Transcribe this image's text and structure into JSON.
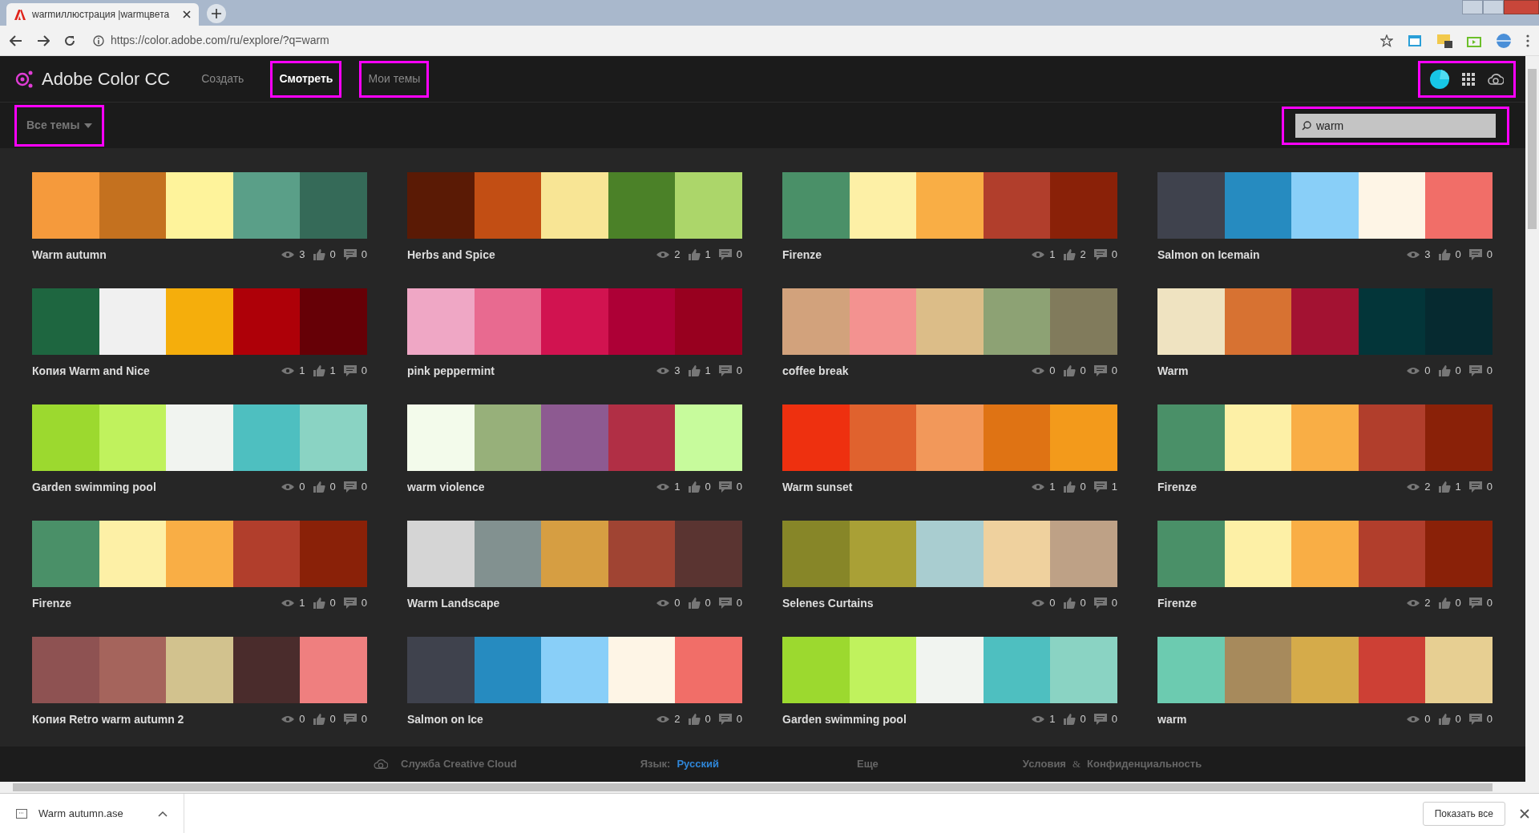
{
  "browser": {
    "tab_title": "warmиллюстрация |warmцвета",
    "url": "https://color.adobe.com/ru/explore/?q=warm"
  },
  "header": {
    "brand": "Adobe Color CC",
    "nav": [
      {
        "label": "Создать",
        "selected": false,
        "highlighted": false
      },
      {
        "label": "Смотреть",
        "selected": true,
        "highlighted": true
      },
      {
        "label": "Мои темы",
        "selected": false,
        "highlighted": true
      }
    ],
    "icons_highlighted": true
  },
  "filter": {
    "label": "Все темы",
    "highlighted": true
  },
  "search": {
    "value": "warm",
    "highlighted": true
  },
  "palettes": [
    {
      "name": "Warm autumn",
      "swatches": [
        {
          "color": "#f59a3c"
        },
        {
          "color": "#c4711f"
        },
        {
          "color": "#fef39b"
        },
        {
          "color": "#5a9f88"
        },
        {
          "color": "#356a58"
        }
      ],
      "views": "3",
      "likes": "0",
      "comments": "0"
    },
    {
      "name": "Herbs and Spice",
      "swatches": [
        {
          "color": "#5a1a05"
        },
        {
          "color": "#c24e14"
        },
        {
          "color": "#f8e595"
        },
        {
          "color": "#4b8128"
        },
        {
          "color": "#acd66a"
        }
      ],
      "views": "2",
      "likes": "1",
      "comments": "0"
    },
    {
      "name": "Firenze",
      "swatches": [
        {
          "color": "#4a9068"
        },
        {
          "color": "#fdf0a6"
        },
        {
          "color": "#f9ae45"
        },
        {
          "color": "#b13e2c"
        },
        {
          "color": "#8a2108"
        }
      ],
      "views": "1",
      "likes": "2",
      "comments": "0"
    },
    {
      "name": "Salmon on Icemain",
      "swatches": [
        {
          "color": "#3f424d"
        },
        {
          "color": "#268bc0"
        },
        {
          "color": "#89cff8"
        },
        {
          "color": "#fef5e6"
        },
        {
          "color": "#f16e68"
        }
      ],
      "views": "3",
      "likes": "0",
      "comments": "0"
    },
    {
      "name": "Копия Warm and Nice",
      "swatches": [
        {
          "color": "#1e6640"
        },
        {
          "color": "#f0f0f0"
        },
        {
          "color": "#f5ae0c"
        },
        {
          "color": "#ae0008"
        },
        {
          "color": "#660006"
        }
      ],
      "views": "1",
      "likes": "1",
      "comments": "0"
    },
    {
      "name": "pink peppermint",
      "swatches": [
        {
          "color": "#efa7c5"
        },
        {
          "color": "#e86a90"
        },
        {
          "color": "#d11350"
        },
        {
          "color": "#ad0036"
        },
        {
          "color": "#98001f"
        }
      ],
      "views": "3",
      "likes": "1",
      "comments": "0"
    },
    {
      "name": "coffee break",
      "swatches": [
        {
          "color": "#d2a27c"
        },
        {
          "color": "#f39290"
        },
        {
          "color": "#dcbd88"
        },
        {
          "color": "#8da274"
        },
        {
          "color": "#817b5c"
        }
      ],
      "views": "0",
      "likes": "0",
      "comments": "0"
    },
    {
      "name": "Warm",
      "swatches": [
        {
          "color": "#efe3c1"
        },
        {
          "color": "#d77232"
        },
        {
          "color": "#a31232"
        },
        {
          "color": "#033539"
        },
        {
          "color": "#062a30"
        }
      ],
      "views": "0",
      "likes": "0",
      "comments": "0"
    },
    {
      "name": "Garden swimming pool",
      "swatches": [
        {
          "color": "#9cd92f"
        },
        {
          "color": "#c0f25d"
        },
        {
          "color": "#f1f4f0"
        },
        {
          "color": "#4ebfc0"
        },
        {
          "color": "#8ad3c3"
        }
      ],
      "views": "0",
      "likes": "0",
      "comments": "0"
    },
    {
      "name": "warm violence",
      "swatches": [
        {
          "color": "#f3fbeb"
        },
        {
          "color": "#97b07a"
        },
        {
          "color": "#8d5a91"
        },
        {
          "color": "#b12f45"
        },
        {
          "color": "#c7fb9c"
        }
      ],
      "views": "1",
      "likes": "0",
      "comments": "0"
    },
    {
      "name": "Warm sunset",
      "swatches": [
        {
          "color": "#ee300f"
        },
        {
          "color": "#e0622e"
        },
        {
          "color": "#f2985a"
        },
        {
          "color": "#df7314"
        },
        {
          "color": "#f39a1b"
        }
      ],
      "views": "1",
      "likes": "0",
      "comments": "1"
    },
    {
      "name": "Firenze",
      "swatches": [
        {
          "color": "#4a9068"
        },
        {
          "color": "#fdf0a6"
        },
        {
          "color": "#f9ae45"
        },
        {
          "color": "#b13e2c"
        },
        {
          "color": "#8a2108"
        }
      ],
      "views": "2",
      "likes": "1",
      "comments": "0"
    },
    {
      "name": "Firenze",
      "swatches": [
        {
          "color": "#4a9068"
        },
        {
          "color": "#fdf0a6"
        },
        {
          "color": "#f9ae45"
        },
        {
          "color": "#b13e2c"
        },
        {
          "color": "#8a2108"
        }
      ],
      "views": "1",
      "likes": "0",
      "comments": "0"
    },
    {
      "name": "Warm Landscape",
      "swatches": [
        {
          "color": "#d5d5d5"
        },
        {
          "color": "#829190"
        },
        {
          "color": "#d69e42"
        },
        {
          "color": "#a04433"
        },
        {
          "color": "#5a3431"
        }
      ],
      "views": "0",
      "likes": "0",
      "comments": "0"
    },
    {
      "name": "Selenes Curtains",
      "swatches": [
        {
          "color": "#878628"
        },
        {
          "color": "#a9a036"
        },
        {
          "color": "#a9cdd0"
        },
        {
          "color": "#efd19e"
        },
        {
          "color": "#bea186"
        }
      ],
      "views": "0",
      "likes": "0",
      "comments": "0"
    },
    {
      "name": "Firenze",
      "swatches": [
        {
          "color": "#4a9068"
        },
        {
          "color": "#fdf0a6"
        },
        {
          "color": "#f9ae45"
        },
        {
          "color": "#b13e2c"
        },
        {
          "color": "#8a2108"
        }
      ],
      "views": "2",
      "likes": "0",
      "comments": "0"
    },
    {
      "name": "Копия Retro warm autumn 2",
      "swatches": [
        {
          "color": "#8e5252"
        },
        {
          "color": "#a5645c"
        },
        {
          "color": "#d2c28e"
        },
        {
          "color": "#4a2c2c"
        },
        {
          "color": "#ef7f7f"
        }
      ],
      "views": "0",
      "likes": "0",
      "comments": "0"
    },
    {
      "name": "Salmon on Ice",
      "swatches": [
        {
          "color": "#3f424d"
        },
        {
          "color": "#268bc0"
        },
        {
          "color": "#89cff8"
        },
        {
          "color": "#fef5e6"
        },
        {
          "color": "#f16e68"
        }
      ],
      "views": "2",
      "likes": "0",
      "comments": "0"
    },
    {
      "name": "Garden swimming pool",
      "swatches": [
        {
          "color": "#9cd92f"
        },
        {
          "color": "#c0f25d"
        },
        {
          "color": "#f1f4f0"
        },
        {
          "color": "#4ebfc0"
        },
        {
          "color": "#8ad3c3"
        }
      ],
      "views": "1",
      "likes": "0",
      "comments": "0"
    },
    {
      "name": "warm",
      "swatches": [
        {
          "color": "#6ccbb0"
        },
        {
          "color": "#a78a5c"
        },
        {
          "color": "#d5ab4a"
        },
        {
          "color": "#cd4035"
        },
        {
          "color": "#e7cf92"
        }
      ],
      "views": "0",
      "likes": "0",
      "comments": "0"
    }
  ],
  "footer": {
    "service": "Служба Creative Cloud",
    "language_label": "Язык:",
    "language": "Русский",
    "more": "Еще",
    "terms": "Условия",
    "amp": "&",
    "privacy": "Конфиденциальность"
  },
  "downloads": {
    "file": "Warm autumn.ase",
    "show_all": "Показать все"
  }
}
